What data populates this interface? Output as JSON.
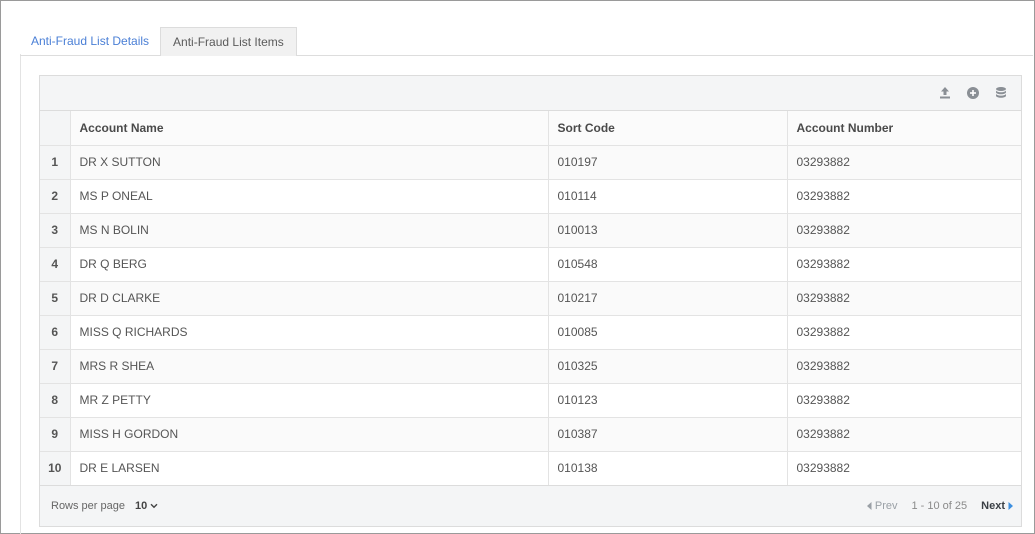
{
  "tabs": [
    {
      "label": "Anti-Fraud List Details",
      "active": false
    },
    {
      "label": "Anti-Fraud List Items",
      "active": true
    }
  ],
  "toolbar": {
    "icons": [
      "upload-icon",
      "add-circle-icon",
      "database-icon"
    ]
  },
  "table": {
    "columns": [
      "Account Name",
      "Sort Code",
      "Account Number"
    ],
    "rows": [
      {
        "index": "1",
        "account_name": "DR X SUTTON",
        "sort_code": "010197",
        "account_number": "03293882"
      },
      {
        "index": "2",
        "account_name": "MS P ONEAL",
        "sort_code": "010114",
        "account_number": "03293882"
      },
      {
        "index": "3",
        "account_name": "MS N BOLIN",
        "sort_code": "010013",
        "account_number": "03293882"
      },
      {
        "index": "4",
        "account_name": "DR Q BERG",
        "sort_code": "010548",
        "account_number": "03293882"
      },
      {
        "index": "5",
        "account_name": "DR D CLARKE",
        "sort_code": "010217",
        "account_number": "03293882"
      },
      {
        "index": "6",
        "account_name": "MISS Q RICHARDS",
        "sort_code": "010085",
        "account_number": "03293882"
      },
      {
        "index": "7",
        "account_name": "MRS R SHEA",
        "sort_code": "010325",
        "account_number": "03293882"
      },
      {
        "index": "8",
        "account_name": "MR Z PETTY",
        "sort_code": "010123",
        "account_number": "03293882"
      },
      {
        "index": "9",
        "account_name": "MISS H GORDON",
        "sort_code": "010387",
        "account_number": "03293882"
      },
      {
        "index": "10",
        "account_name": "DR E LARSEN",
        "sort_code": "010138",
        "account_number": "03293882"
      }
    ]
  },
  "footer": {
    "rows_per_page_label": "Rows per page",
    "rows_per_page_value": "10",
    "prev_label": "Prev",
    "range_text": "1 - 10 of 25",
    "next_label": "Next"
  },
  "colors": {
    "tab_link": "#4a7fd6",
    "next_arrow": "#3d8fe0"
  }
}
